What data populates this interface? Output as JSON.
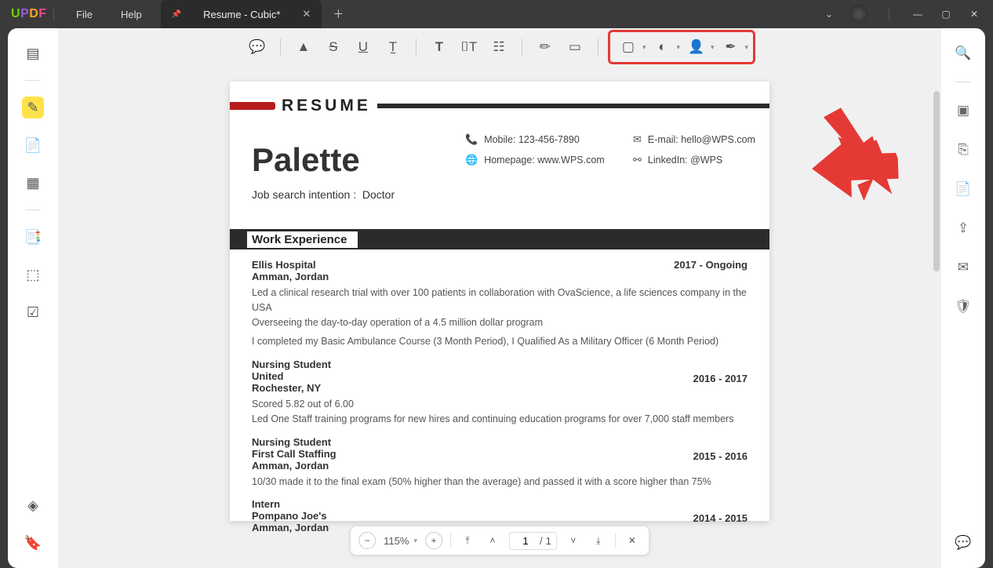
{
  "menu": {
    "file": "File",
    "help": "Help"
  },
  "tab": {
    "title": "Resume - Cubic*"
  },
  "resume": {
    "heading": "RESUME",
    "name": "Palette",
    "job_label": "Job search intention :",
    "job_value": "Doctor",
    "contacts": {
      "mobile_label": "Mobile: 123-456-7890",
      "email_label": "E-mail: hello@WPS.com",
      "homepage_label": "Homepage:  www.WPS.com",
      "linkedin_label": "LinkedIn: @WPS"
    },
    "section1": "Work Experience",
    "e1": {
      "title": "Ellis Hospital",
      "sub": "Amman,   Jordan",
      "date": "2017  - Ongoing",
      "l1": "Led a clinical research trial with over 100 patients in collaboration with OvaScience, a life sciences company in the USA",
      "l2": "Overseeing the day-to-day operation of a 4.5 million dollar program",
      "l3": "I completed my Basic Ambulance Course (3 Month Period), I Qualified As a Military Officer (6 Month Period)"
    },
    "e2": {
      "title": "Nursing Student",
      "sub1": "United",
      "sub2": "Rochester, NY",
      "date": "2016  - 2017",
      "l1": "Scored 5.82 out of 6.00",
      "l2": "Led  One  Staff  training  programs  for  new hires and continuing education programs for over 7,000 staff members"
    },
    "e3": {
      "title": "Nursing Student",
      "sub1": "First Call Staffing",
      "sub2": "Amman,   Jordan",
      "date": "2015  - 2016",
      "l1": "10/30 made it to the final exam (50% higher than the average) and passed it with a score higher than 75%"
    },
    "e4": {
      "title": "Intern",
      "sub1": "Pompano Joe's",
      "sub2": "Amman,   Jordan",
      "date": "2014  - 2015"
    }
  },
  "pagectrl": {
    "zoom": "115%",
    "page": "1",
    "total": "1",
    "sep": "/"
  }
}
